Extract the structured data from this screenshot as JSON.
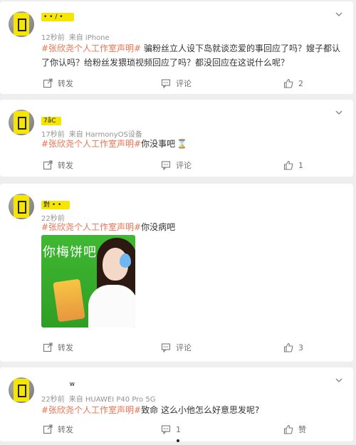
{
  "comments": [
    {
      "username": "• • / •",
      "time": "12秒前",
      "source": "来自 iPhone",
      "hashtag": "#张欣尧个人工作室声明#",
      "text": " 骗粉丝立人设下岛就谈恋爱的事回应了吗？嫂子都认了你认吗？给粉丝发猥琐视频回应了吗？都没回应在这说什么呢？",
      "actions": {
        "repost": "转发",
        "comment": "评论",
        "like": "2"
      }
    },
    {
      "username": "7åC",
      "time": "17秒前",
      "source": "来自 HarmonyOS设备",
      "hashtag": "#张欣尧个人工作室声明#",
      "text": "你没事吧",
      "emoji": "⌛",
      "actions": {
        "repost": "转发",
        "comment": "评论",
        "like": "1"
      }
    },
    {
      "username": "對 • •",
      "time": "22秒前",
      "source": "",
      "hashtag": "#张欣尧个人工作室声明#",
      "text": "你没病吧",
      "image_text": "你梅饼吧",
      "actions": {
        "repost": "转发",
        "comment": "评论",
        "like": "3"
      }
    },
    {
      "username": "w",
      "time": "22秒前",
      "source": "来自 HUAWEI P40 Pro 5G",
      "hashtag": "#张欣尧个人工作室声明#",
      "text": "致命 这么小他怎么好意思发呢?",
      "actions": {
        "repost": "转发",
        "comment": "1",
        "like": "赞"
      }
    }
  ]
}
